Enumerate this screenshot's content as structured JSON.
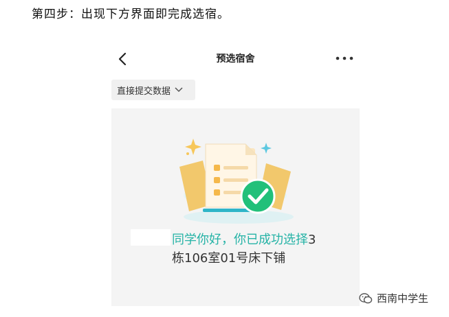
{
  "document": {
    "step_text": "第四步：出现下方界面即完成选宿。"
  },
  "app": {
    "nav": {
      "title": "预选宿舍",
      "back_icon": "chevron-left-icon",
      "more_icon": "ellipsis-icon"
    },
    "mode_selector": {
      "label": "直接提交数据",
      "icon": "chevron-down-icon"
    },
    "result": {
      "message_highlight": "同学你好，你已成功选择",
      "message_rest_1": "3",
      "message_rest_2": "栋106室01号床下铺",
      "accent_color": "#25b3a6",
      "success_color": "#22c07a"
    }
  },
  "watermark": {
    "label": "西南中学生",
    "icon": "wechat-official-account-icon"
  }
}
